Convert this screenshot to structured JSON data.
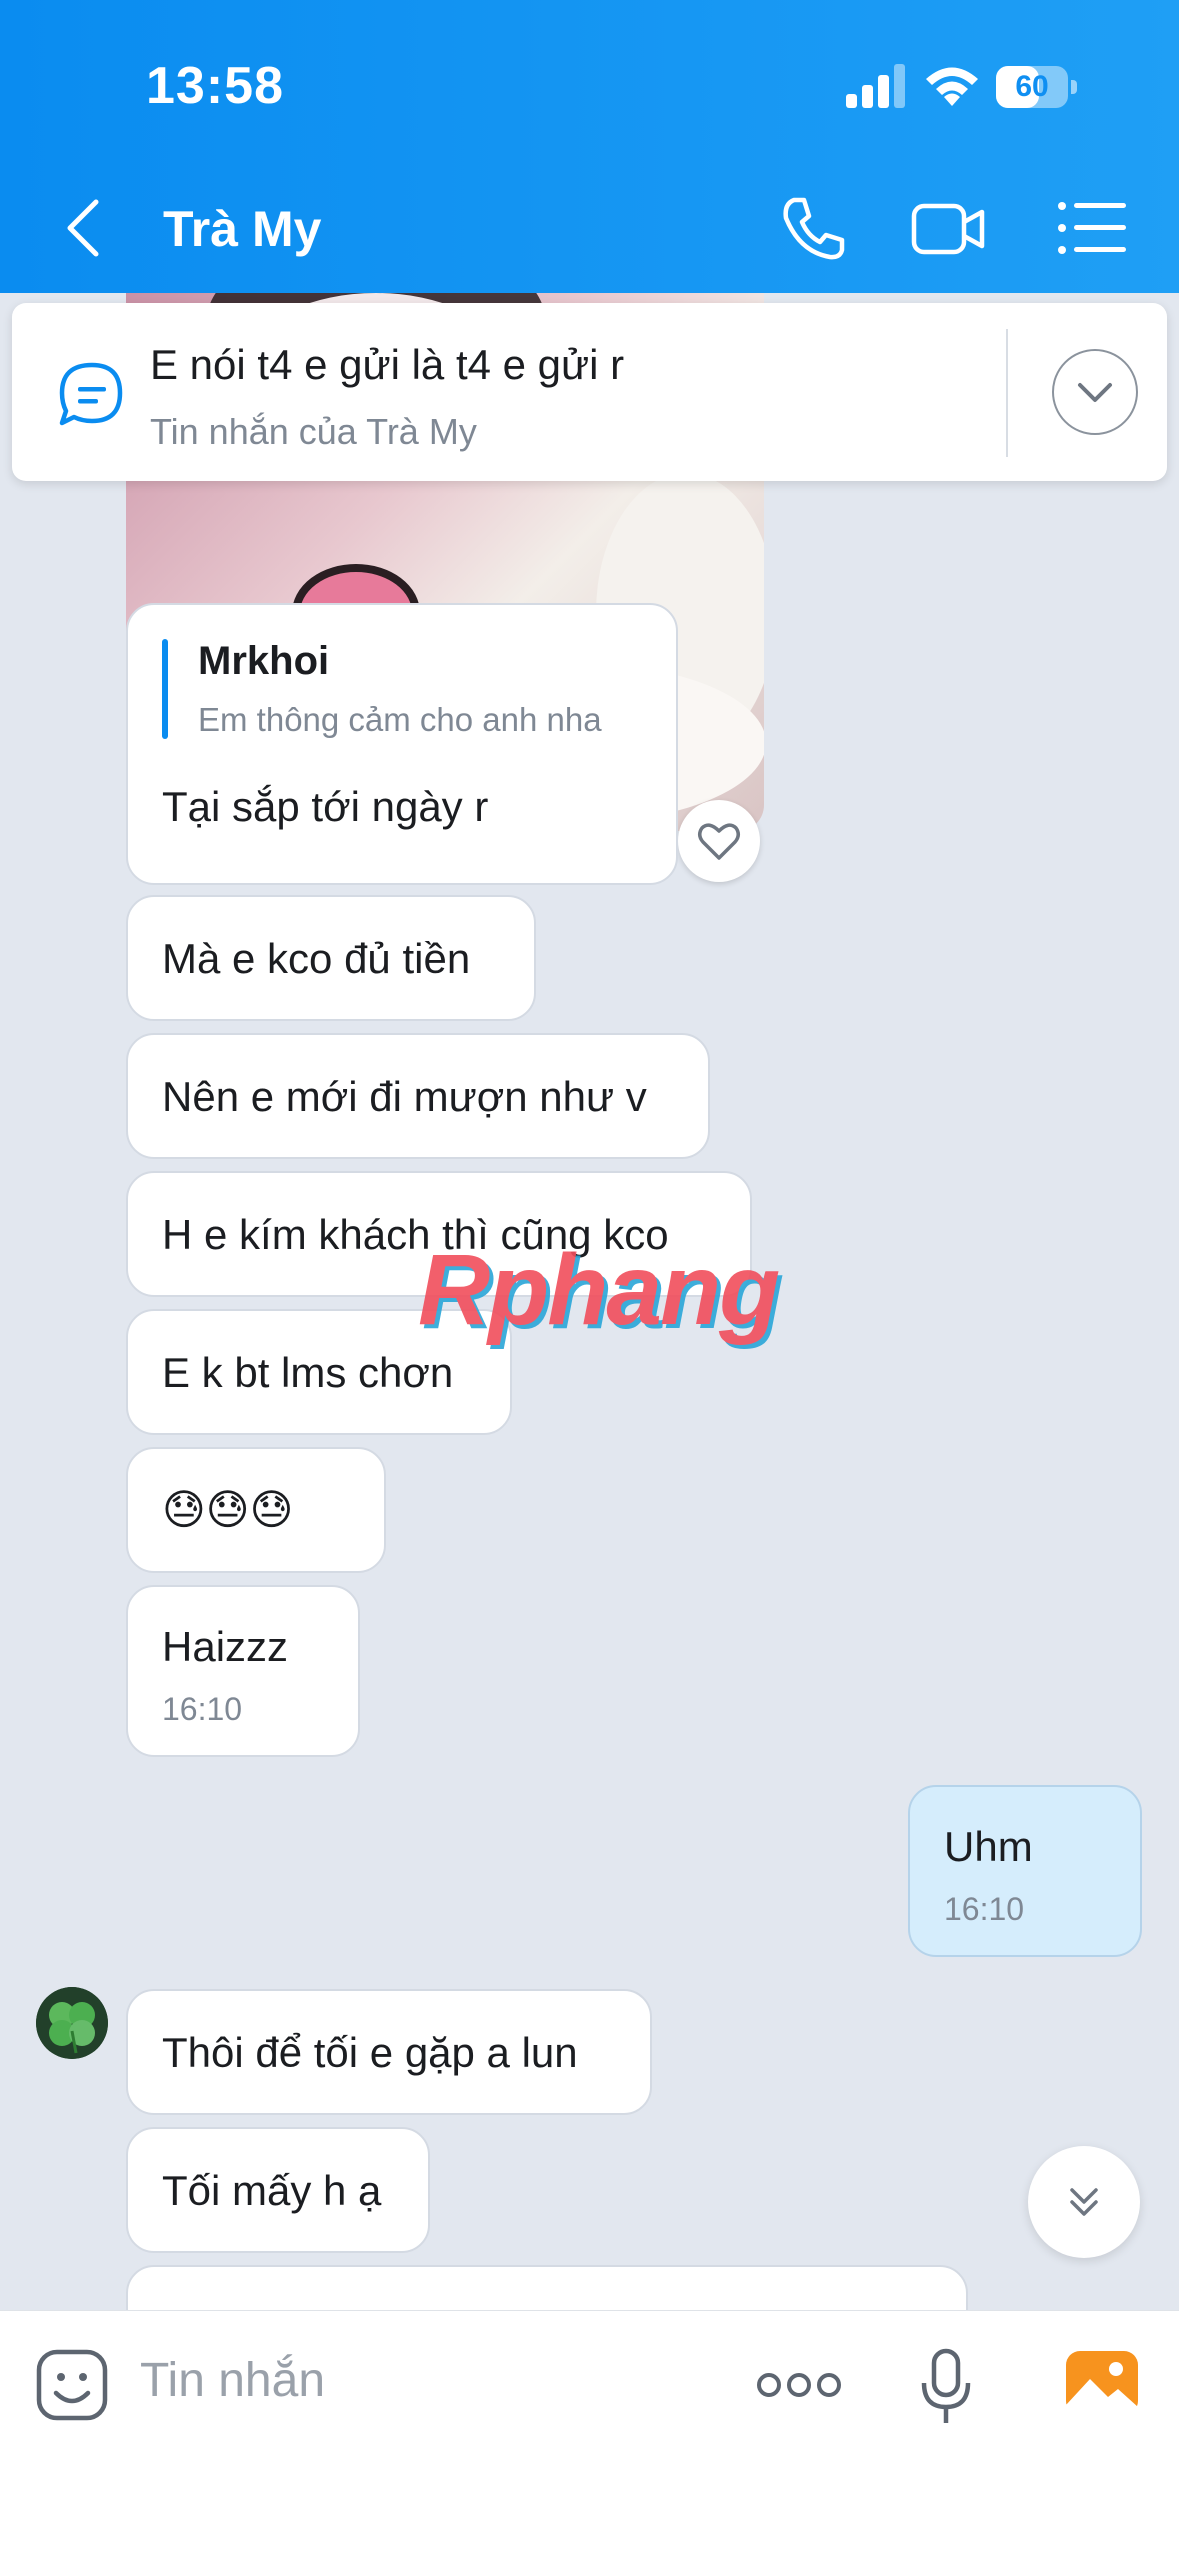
{
  "status_bar": {
    "time": "13:58",
    "battery": "60",
    "battery_level_percent": 60
  },
  "header": {
    "title": "Trà My",
    "icons": [
      "back-icon",
      "phone-icon",
      "video-icon",
      "list-icon"
    ]
  },
  "pinned": {
    "message": "E nói t4 e gửi là t4 e gửi r",
    "source": "Tin nhắn của Trà My"
  },
  "messages": [
    {
      "quote_name": "Mrkhoi",
      "quote_text": "Em thông cảm cho anh nha",
      "text": "Tại sắp tới ngày r"
    },
    {
      "text": "Mà e kco đủ tiền"
    },
    {
      "text": "Nên e mới đi mượn như v"
    },
    {
      "text": "H e kím khách thì cũng kco"
    },
    {
      "text": "E k bt lms chơn"
    },
    {
      "text": "😓😓😓"
    },
    {
      "text": "Haizzz",
      "time": "16:10"
    },
    {
      "text": "Uhm",
      "time": "16:10"
    },
    {
      "text": "Thôi để tối e gặp a lun"
    },
    {
      "text": "Tối mấy h ạ"
    }
  ],
  "watermark": "Rphang",
  "composer": {
    "placeholder": "Tin nhắn"
  },
  "colors": {
    "header": "#0a8cf0",
    "sent_bubble": "#d5edfc",
    "background": "#e2e7ef"
  }
}
